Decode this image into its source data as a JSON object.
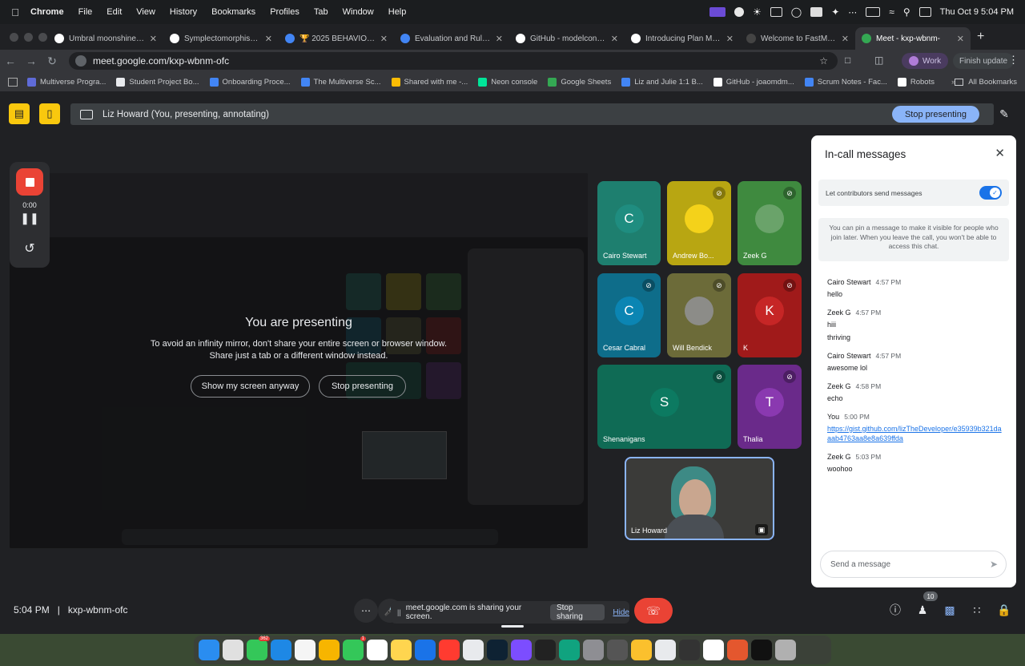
{
  "menubar": {
    "app": "Chrome",
    "items": [
      "File",
      "Edit",
      "View",
      "History",
      "Bookmarks",
      "Profiles",
      "Tab",
      "Window",
      "Help"
    ],
    "datetime": "Thu Oct 9  5:04 PM"
  },
  "tabs": [
    {
      "title": "Umbral moonshine - W",
      "color": "#ffffff"
    },
    {
      "title": "Symplectomorphism - ",
      "color": "#ffffff"
    },
    {
      "title": "🏆 2025 BEHAVIOR Ch",
      "color": "#4285f4"
    },
    {
      "title": "Evaluation and Rules -",
      "color": "#4285f4"
    },
    {
      "title": "GitHub - modelcontextp",
      "color": "#ffffff"
    },
    {
      "title": "Introducing Plan Mode",
      "color": "#ffffff"
    },
    {
      "title": "Welcome to FastMCP 2",
      "color": "#444444"
    },
    {
      "title": "Meet - kxp-wbnm-",
      "color": "#34a853"
    }
  ],
  "address": {
    "url": "meet.google.com/kxp-wbnm-ofc",
    "profile": "Work",
    "update": "Finish update"
  },
  "bookmarks": [
    {
      "label": "Multiverse Progra...",
      "color": "#5f6bd8"
    },
    {
      "label": "Student Project Bo...",
      "color": "#e8eaed"
    },
    {
      "label": "Onboarding Proce...",
      "color": "#4285f4"
    },
    {
      "label": "The Multiverse Sc...",
      "color": "#4285f4"
    },
    {
      "label": "Shared with me -...",
      "color": "#fbbc04"
    },
    {
      "label": "Neon console",
      "color": "#00e599"
    },
    {
      "label": "Google Sheets",
      "color": "#34a853"
    },
    {
      "label": "Liz and Julie 1:1 B...",
      "color": "#4285f4"
    },
    {
      "label": "GitHub - joaomdm...",
      "color": "#ffffff"
    },
    {
      "label": "Scrum Notes - Fac...",
      "color": "#4285f4"
    },
    {
      "label": "Robots",
      "color": "#ffffff"
    }
  ],
  "all_bookmarks": "All Bookmarks",
  "presenting_bar": {
    "label": "Liz Howard (You, presenting, annotating)",
    "stop_button": "Stop presenting"
  },
  "recorder": {
    "time": "0:00"
  },
  "presentation": {
    "title": "You are presenting",
    "line1": "To avoid an infinity mirror, don't share your entire screen or browser window.",
    "line2": "Share just a tab or a different window instead.",
    "show_button": "Show my screen anyway",
    "stop_button": "Stop presenting"
  },
  "participants": [
    {
      "name": "Cairo Stewart",
      "initial": "C",
      "bg": "#1e7f6f",
      "avatar_bg": "#1f8d80",
      "muted": false
    },
    {
      "name": "Andrew Bo...",
      "initial": "",
      "bg": "#b8a612",
      "avatar_bg": "#f4d21a",
      "muted": true
    },
    {
      "name": "Zeek G",
      "initial": "",
      "bg": "#3f8a3f",
      "avatar_bg": "#6aa36a",
      "muted": true
    },
    {
      "name": "Cesar Cabral",
      "initial": "C",
      "bg": "#0e6d8a",
      "avatar_bg": "#0b85b3",
      "muted": true
    },
    {
      "name": "Will Bendick",
      "initial": "",
      "bg": "#6c6b39",
      "avatar_bg": "#8c8c88",
      "muted": true
    },
    {
      "name": "K",
      "initial": "K",
      "bg": "#a01a1a",
      "avatar_bg": "#c62626",
      "muted": true
    },
    {
      "name": "Shenanigans",
      "initial": "S",
      "bg": "#0f6b55",
      "avatar_bg": "#0c7a61",
      "muted": true
    },
    {
      "name": "Thalia",
      "initial": "T",
      "bg": "#6a2a8a",
      "avatar_bg": "#8a39b0",
      "muted": true
    }
  ],
  "self_tile": {
    "name": "Liz Howard"
  },
  "chat": {
    "title": "In-call messages",
    "toggle_label": "Let contributors send messages",
    "toggle_on": true,
    "pin_note": "You can pin a message to make it visible for people who join later. When you leave the call, you won't be able to access this chat.",
    "messages": [
      {
        "sender": "Cairo Stewart",
        "time": "4:57 PM",
        "lines": [
          "hello"
        ]
      },
      {
        "sender": "Zeek G",
        "time": "4:57 PM",
        "lines": [
          "hiii",
          "thriving"
        ]
      },
      {
        "sender": "Cairo Stewart",
        "time": "4:57 PM",
        "lines": [
          "awesome lol"
        ]
      },
      {
        "sender": "Zeek G",
        "time": "4:58 PM",
        "lines": [
          "echo"
        ]
      },
      {
        "sender": "You",
        "time": "5:00 PM",
        "link": "https://gist.github.com/lizTheDeveloper/e35939b321daaab4763aa8e8a639ffda"
      },
      {
        "sender": "Zeek G",
        "time": "5:03 PM",
        "lines": [
          "woohoo"
        ]
      }
    ],
    "send_placeholder": "Send a message"
  },
  "bottom": {
    "time": "5:04 PM",
    "meeting_code": "kxp-wbnm-ofc",
    "sharing_text": "meet.google.com is sharing your screen.",
    "stop_sharing": "Stop sharing",
    "hide": "Hide",
    "people_count": "10"
  },
  "dock_icons": [
    {
      "name": "finder",
      "color": "#2a8df0"
    },
    {
      "name": "launchpad",
      "color": "#e0e0e0"
    },
    {
      "name": "messages",
      "color": "#34c759",
      "badge": "362"
    },
    {
      "name": "safari",
      "color": "#1e88e5"
    },
    {
      "name": "freeform",
      "color": "#f5f5f5"
    },
    {
      "name": "photos",
      "color": "#f7b500"
    },
    {
      "name": "facetime",
      "color": "#34c759",
      "badge": "1"
    },
    {
      "name": "reminders",
      "color": "#ffffff"
    },
    {
      "name": "notes",
      "color": "#ffd54f"
    },
    {
      "name": "app-store",
      "color": "#1a73e8"
    },
    {
      "name": "news",
      "color": "#ff3b30"
    },
    {
      "name": "chrome",
      "color": "#e8eaed"
    },
    {
      "name": "warp",
      "color": "#0e2233"
    },
    {
      "name": "obsidian",
      "color": "#7c4dff"
    },
    {
      "name": "terminal",
      "color": "#222222"
    },
    {
      "name": "chatgpt",
      "color": "#10a37f"
    },
    {
      "name": "system-settings",
      "color": "#8e8e93"
    },
    {
      "name": "sublime",
      "color": "#555555"
    },
    {
      "name": "bee",
      "color": "#fbc02d"
    },
    {
      "name": "openai",
      "color": "#e8eaed"
    },
    {
      "name": "audio",
      "color": "#333333"
    },
    {
      "name": "textedit",
      "color": "#ffffff"
    },
    {
      "name": "claude",
      "color": "#e4572e"
    },
    {
      "name": "cursor",
      "color": "#111111"
    },
    {
      "name": "trash",
      "color": "#b0b0b0"
    }
  ]
}
